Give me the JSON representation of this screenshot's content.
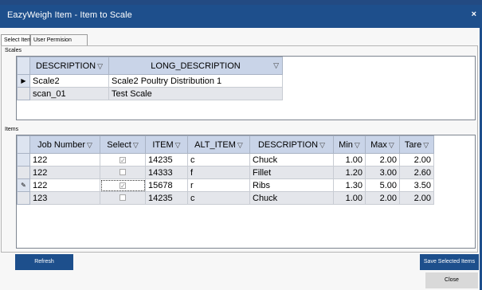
{
  "window": {
    "title": "EazyWeigh Item - Item to Scale",
    "close_glyph": "×"
  },
  "tabs": [
    {
      "label": "Select Item",
      "active": true
    },
    {
      "label": "User Permision",
      "active": false
    }
  ],
  "scales": {
    "group_label": "Scales",
    "columns": [
      "DESCRIPTION",
      "LONG_DESCRIPTION"
    ],
    "rows": [
      {
        "current": true,
        "description": "Scale2",
        "long_description": "Scale2 Poultry Distribution 1"
      },
      {
        "current": false,
        "description": "scan_01",
        "long_description": "Test Scale"
      }
    ]
  },
  "items": {
    "group_label": "Items",
    "columns": [
      "Job Number",
      "Select",
      "ITEM",
      "ALT_ITEM",
      "DESCRIPTION",
      "Min",
      "Max",
      "Tare"
    ],
    "rows": [
      {
        "job": "122",
        "select": true,
        "item": "14235",
        "alt_item": "c",
        "description": "Chuck",
        "min": "1.00",
        "max": "2.00",
        "tare": "2.00",
        "editing": false
      },
      {
        "job": "122",
        "select": false,
        "item": "14333",
        "alt_item": "f",
        "description": "Fillet",
        "min": "1.20",
        "max": "3.00",
        "tare": "2.60",
        "editing": false
      },
      {
        "job": "122",
        "select": true,
        "item": "15678",
        "alt_item": "r",
        "description": "Ribs",
        "min": "1.30",
        "max": "5.00",
        "tare": "3.50",
        "editing": true
      },
      {
        "job": "123",
        "select": false,
        "item": "14235",
        "alt_item": "c",
        "description": "Chuck",
        "min": "1.00",
        "max": "2.00",
        "tare": "2.00",
        "editing": false
      }
    ]
  },
  "icons": {
    "filter": "filter-icon",
    "current_row": "row-arrow-icon",
    "edit_row": "pencil-icon"
  },
  "buttons": {
    "refresh": "Refresh",
    "save_selected": "Save Selected Items",
    "close": "Close"
  },
  "colors": {
    "title_bar": "#1e4f8c",
    "header": "#c9d4e8",
    "button_blue": "#1d4f8c"
  }
}
